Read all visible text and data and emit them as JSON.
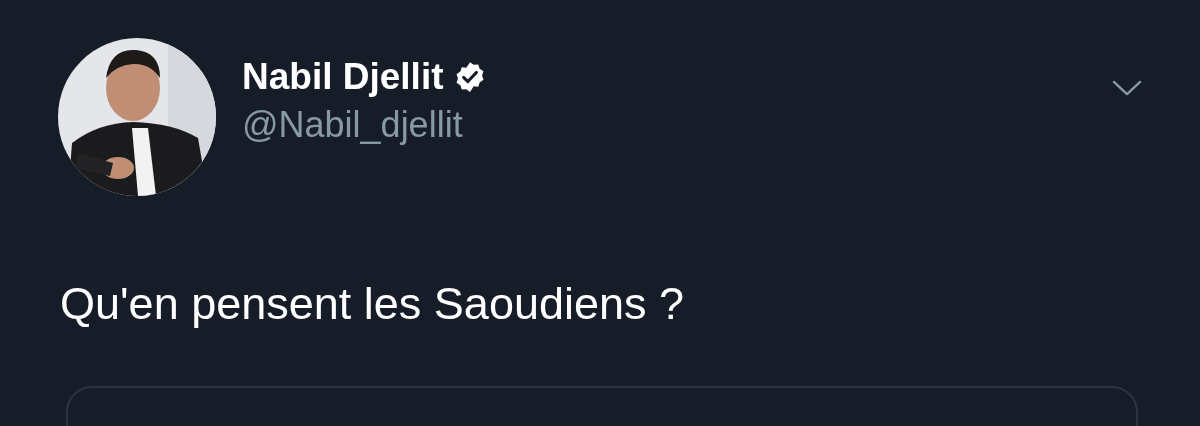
{
  "tweet": {
    "author": {
      "name": "Nabil Djellit",
      "verified": true,
      "handle": "@Nabil_djellit"
    },
    "text": "Qu'en pensent les Saoudiens ?",
    "quoted_card": {
      "kind": "card"
    }
  }
}
